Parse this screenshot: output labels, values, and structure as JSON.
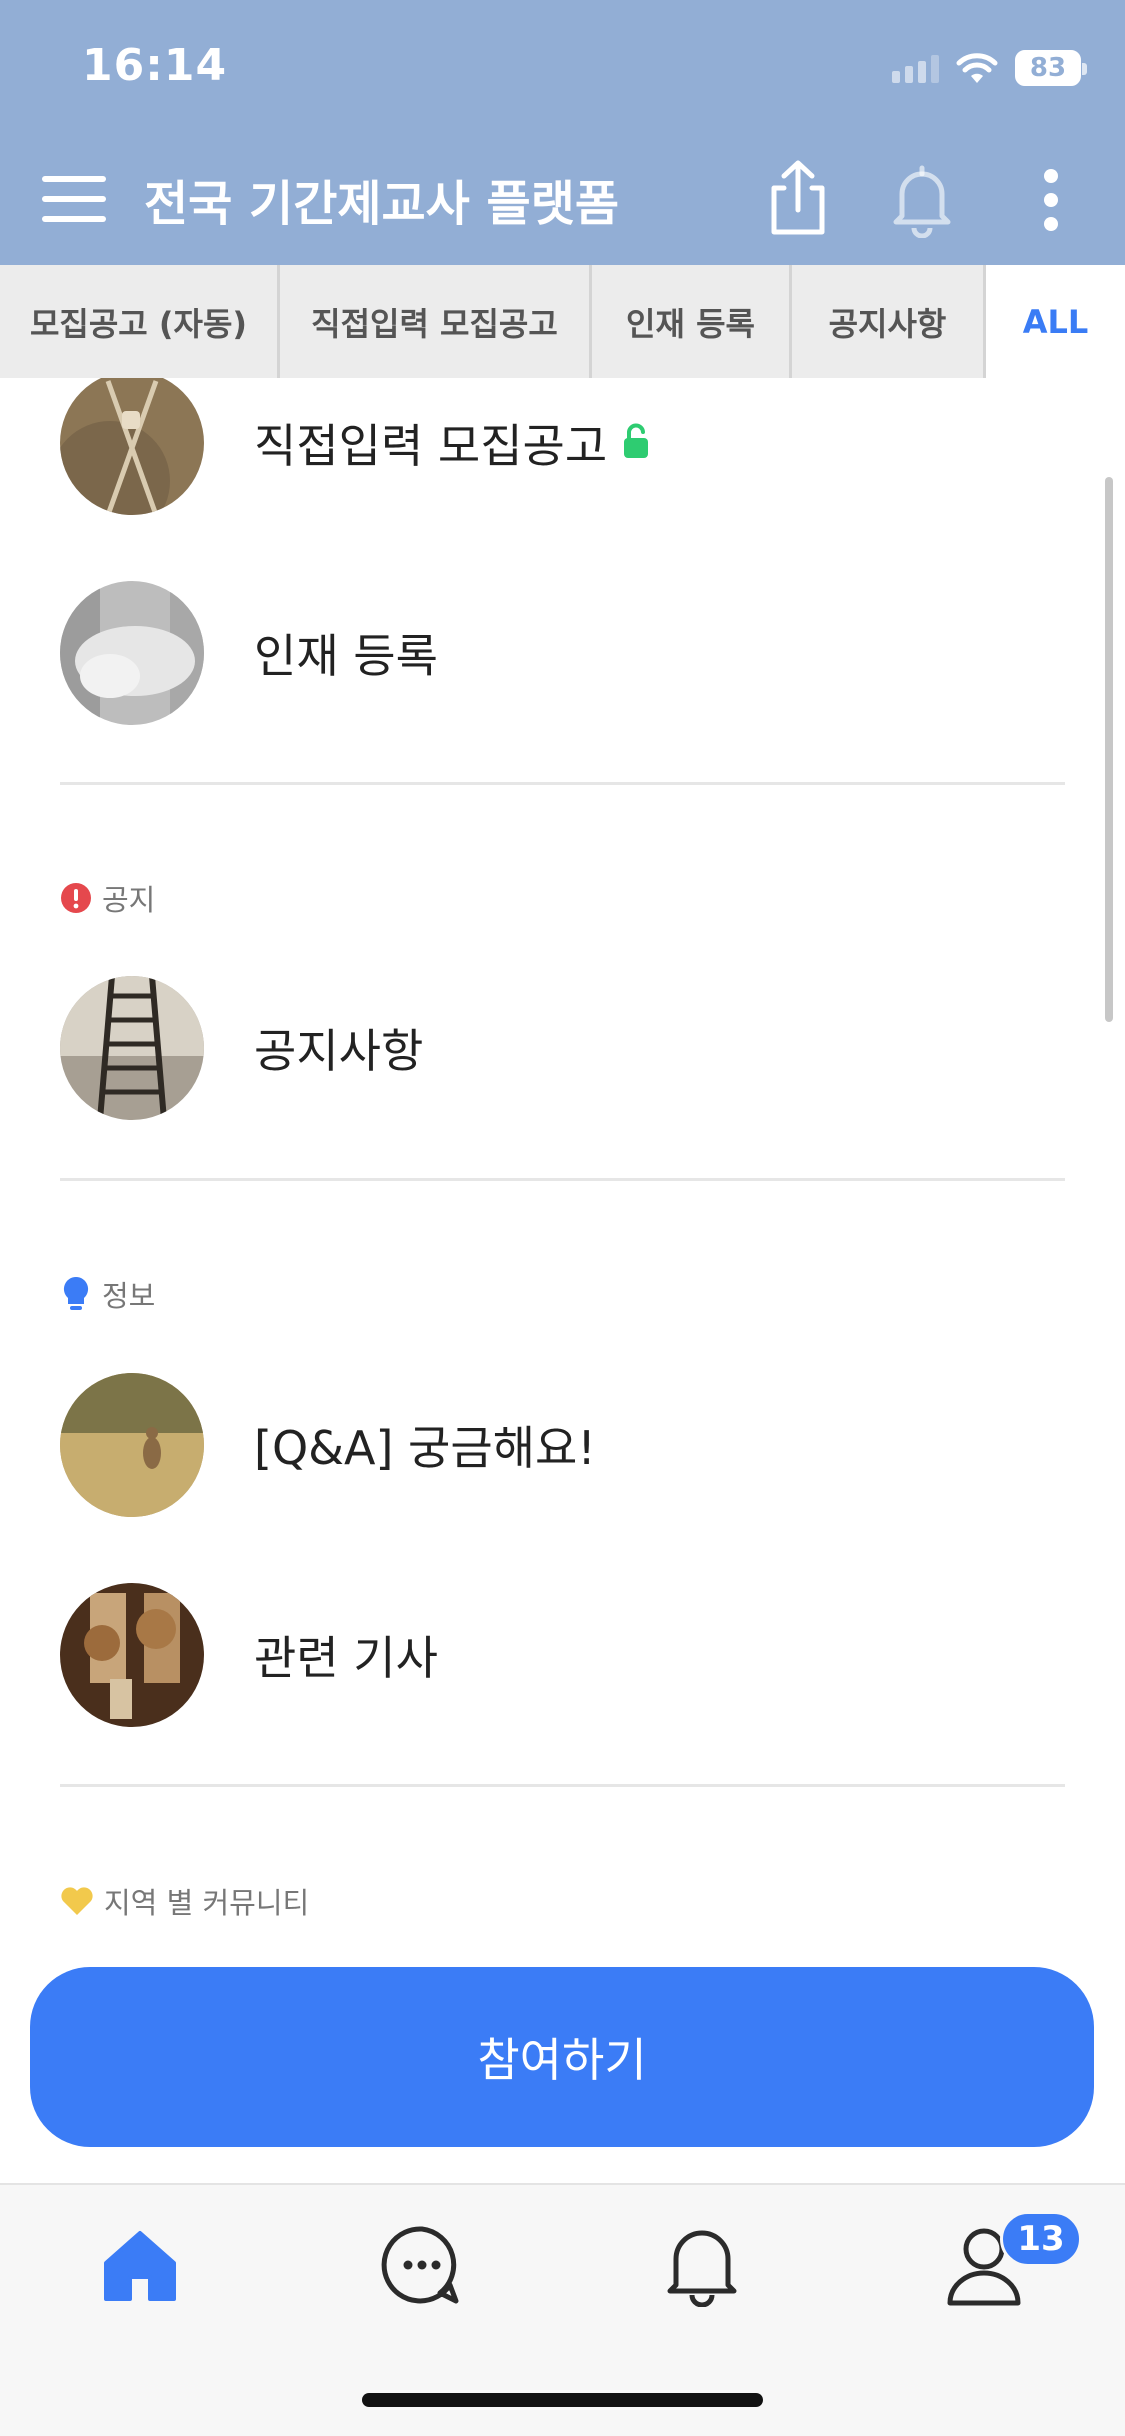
{
  "status_bar": {
    "time": "16:14",
    "battery": "83"
  },
  "header": {
    "title": "전국 기간제교사 플랫폼"
  },
  "tabs": [
    {
      "label": "모집공고 (자동)"
    },
    {
      "label": "직접입력 모집공고"
    },
    {
      "label": "인재 등록"
    },
    {
      "label": "공지사항"
    },
    {
      "label": "ALL"
    }
  ],
  "list": {
    "items": [
      {
        "label": "직접입력 모집공고"
      },
      {
        "label": "인재 등록"
      },
      {
        "label": "공지사항"
      },
      {
        "label": "[Q&A] 궁금해요!"
      },
      {
        "label": "관련 기사"
      }
    ],
    "sections": [
      {
        "label": "공지"
      },
      {
        "label": "정보"
      },
      {
        "label": "지역 별 커뮤니티"
      }
    ]
  },
  "join_button": {
    "label": "참여하기"
  },
  "bottom_nav": {
    "profile_badge": "13"
  },
  "colors": {
    "header": "#92aed5",
    "accent": "#3b7cf6",
    "lock": "#2ecc71",
    "notice": "#e5484d",
    "info": "#3b7cf6",
    "community": "#f2c94c"
  }
}
